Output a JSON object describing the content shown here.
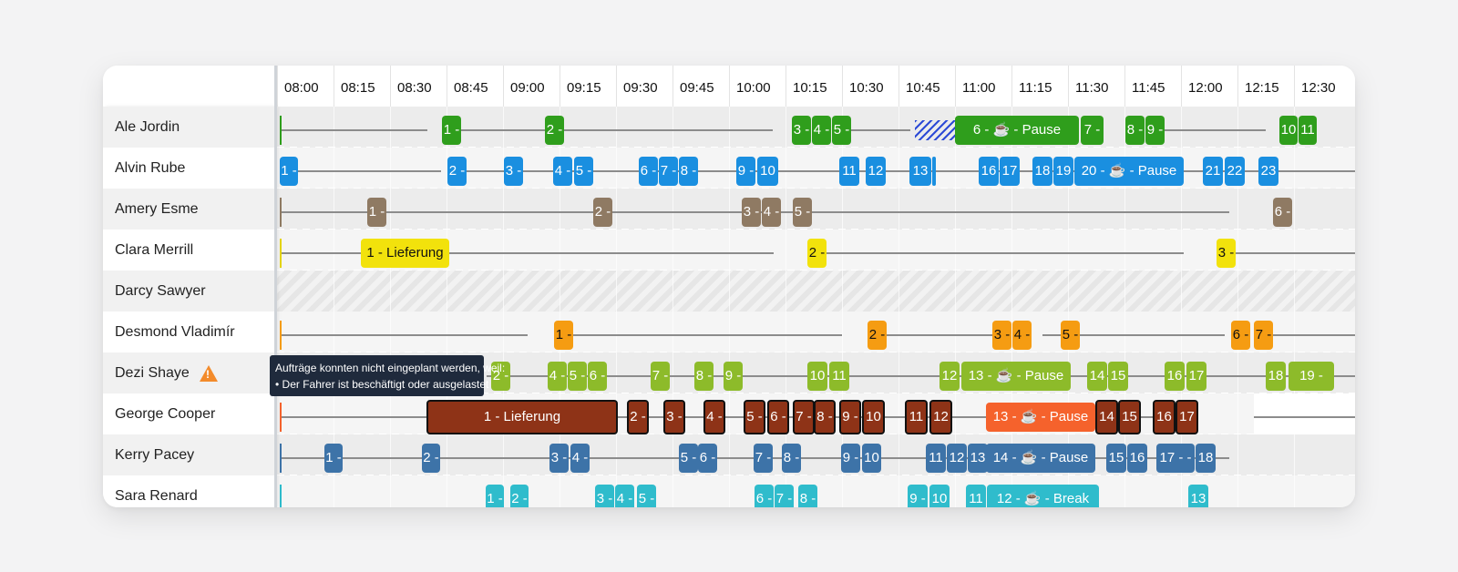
{
  "times": [
    "08:00",
    "08:15",
    "08:30",
    "08:45",
    "09:00",
    "09:15",
    "09:30",
    "09:45",
    "10:00",
    "10:15",
    "10:30",
    "10:45",
    "11:00",
    "11:15",
    "11:30",
    "11:45",
    "12:00",
    "12:15",
    "12:30"
  ],
  "drivers": [
    "Ale Jordin",
    "Alvin Rube",
    "Amery Esme",
    "Clara Merrill",
    "Darcy Sawyer",
    "Desmond Vladimír",
    "Dezi Shaye",
    "George Cooper",
    "Kerry Pacey",
    "Sara Renard"
  ],
  "warning_icon": "warning-triangle-icon",
  "tooltip": {
    "line1": "Aufträge konnten nicht eingeplant werden, weil:",
    "line2": "Der Fahrer ist beschäftigt oder ausgelastet"
  },
  "colors": {
    "green": "#2f9e1c",
    "blue": "#1a8fe0",
    "brown": "#8f7a63",
    "yellow": "#f2e20c",
    "orange": "#f59c12",
    "lime": "#8dbb2a",
    "darkred": "#8e3317",
    "red": "#f5622c",
    "steel": "#3d73a8",
    "teal": "#2fbccc"
  },
  "jobs": {
    "ale": [
      "1 -",
      "2 -",
      "3 -",
      "4 -",
      "5 -",
      "6 - ☕ - Pause",
      "7 -",
      "8 -",
      "9 -",
      "10",
      "11"
    ],
    "alvin": [
      "1 -",
      "2 -",
      "3 -",
      "4 -",
      "5 -",
      "6 -",
      "7 -",
      "8 -",
      "9 -",
      "10",
      "11",
      "12",
      "13",
      "16",
      "17",
      "18",
      "19",
      "20 - ☕ - Pause",
      "21",
      "22",
      "23"
    ],
    "amery": [
      "1 -",
      "2 -",
      "3 -",
      "4 -",
      "5 -",
      "6 -"
    ],
    "clara": [
      "1 - Lieferung",
      "2 -",
      "3 -"
    ],
    "desmond": [
      "1 -",
      "2 -",
      "3 -",
      "4 -",
      "5 -",
      "6 -",
      "7 -"
    ],
    "dezi": [
      "2 -",
      "4 -",
      "5 -",
      "6 -",
      "7 -",
      "8 -",
      "9 -",
      "10",
      "11",
      "12",
      "13 - ☕ - Pause",
      "14",
      "15",
      "16",
      "17",
      "18",
      "19 -"
    ],
    "george": [
      "1 - Lieferung",
      "2 -",
      "3 -",
      "4 -",
      "5 -",
      "6 -",
      "7 -",
      "8 -",
      "9 -",
      "10",
      "11",
      "12",
      "13 - ☕ - Pause",
      "14",
      "15",
      "16",
      "17"
    ],
    "kerry": [
      "1 -",
      "2 -",
      "3 -",
      "4 -",
      "5 -",
      "6 -",
      "7 -",
      "8 -",
      "9 -",
      "10",
      "11",
      "12",
      "13",
      "14 - ☕ - Pause",
      "15",
      "16",
      "17 - -",
      "18"
    ],
    "sara": [
      "1 -",
      "2 -",
      "3 -",
      "4 -",
      "5 -",
      "6 -",
      "7 -",
      "8 -",
      "9 -",
      "10",
      "11",
      "12 - ☕ - Break",
      "13"
    ]
  }
}
